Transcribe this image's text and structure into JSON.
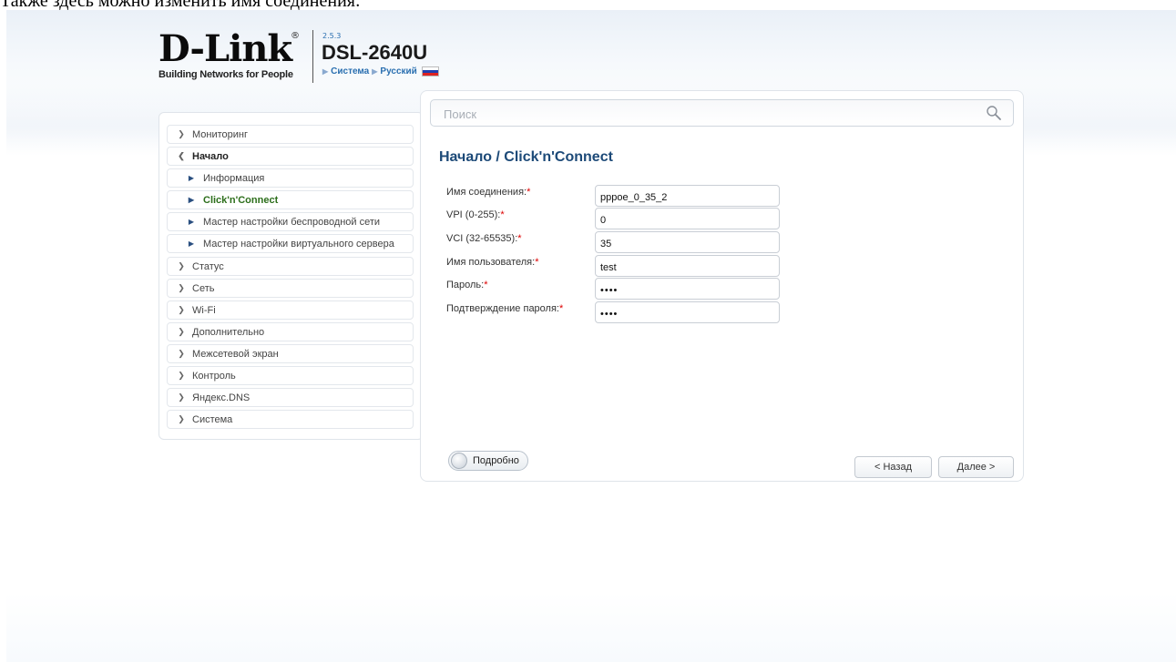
{
  "doc_caption": "Также здесь можно изменить имя соединения:",
  "header": {
    "logo_text": "D-Link",
    "logo_reg": "®",
    "logo_tagline": "Building Networks for People",
    "firmware_version": "2.5.3",
    "model": "DSL-2640U",
    "nav_system": "Система",
    "nav_language": "Русский"
  },
  "sidebar": {
    "items": [
      {
        "label": "Мониторинг"
      },
      {
        "label": "Начало"
      },
      {
        "label": "Информация"
      },
      {
        "label": "Click'n'Connect"
      },
      {
        "label": "Мастер настройки беспроводной сети"
      },
      {
        "label": "Мастер настройки виртуального сервера"
      },
      {
        "label": "Статус"
      },
      {
        "label": "Сеть"
      },
      {
        "label": "Wi-Fi"
      },
      {
        "label": "Дополнительно"
      },
      {
        "label": "Межсетевой экран"
      },
      {
        "label": "Контроль"
      },
      {
        "label": "Яндекс.DNS"
      },
      {
        "label": "Система"
      }
    ]
  },
  "search": {
    "placeholder": "Поиск"
  },
  "page": {
    "title": "Начало /  Click'n'Connect"
  },
  "form": {
    "connection_name": {
      "label": "Имя соединения:",
      "value": "pppoe_0_35_2"
    },
    "vpi": {
      "label": "VPI (0-255):",
      "value": "0"
    },
    "vci": {
      "label": "VCI (32-65535):",
      "value": "35"
    },
    "username": {
      "label": "Имя пользователя:",
      "value": "test"
    },
    "password": {
      "label": "Пароль:",
      "value": "••••"
    },
    "password_confirm": {
      "label": "Подтверждение пароля:",
      "value": "••••"
    },
    "required_mark": "*"
  },
  "footer": {
    "details_toggle": "Подробно",
    "back_button": "< Назад",
    "next_button": "Далее >"
  },
  "colors": {
    "title_blue": "#1d4a78",
    "active_green": "#2c6e1b",
    "required_red": "#dd0000",
    "link_blue": "#2a6fb0"
  }
}
